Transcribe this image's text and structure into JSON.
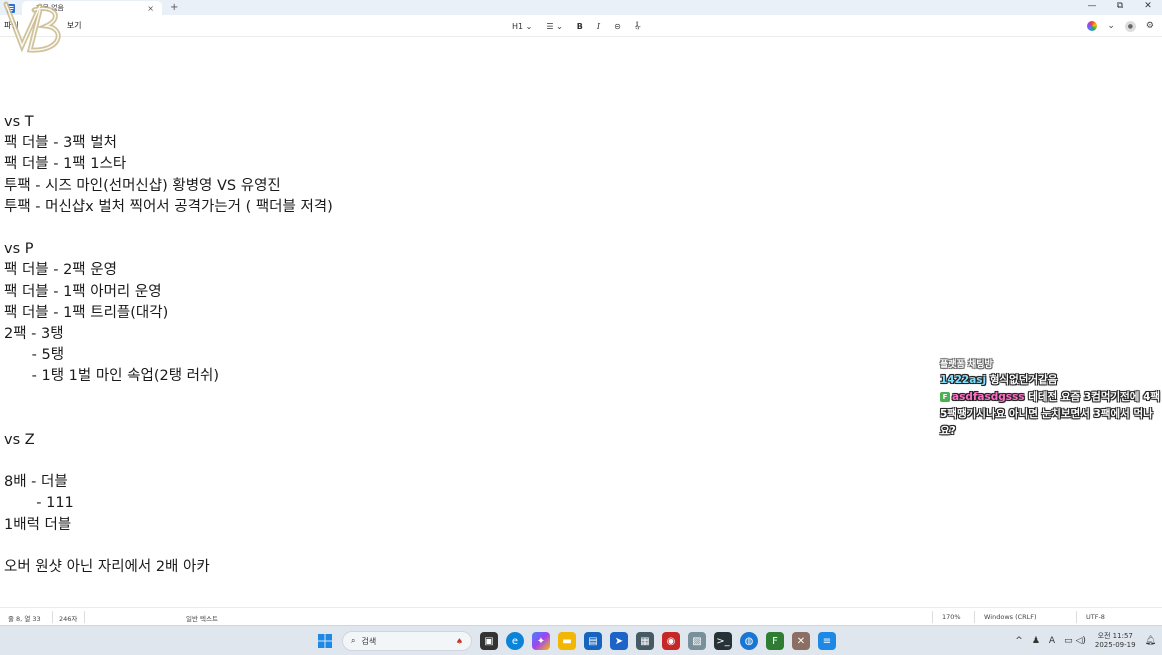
{
  "window": {
    "tab_title": "제목 없음",
    "tab_close": "×",
    "new_tab": "+",
    "minimize": "—",
    "maximize": "⧉",
    "close": "✕"
  },
  "menubar": {
    "file": "파일",
    "view": "보기"
  },
  "toolbar": {
    "heading": "H1 ⌄",
    "list": "☰ ⌄",
    "bold": "B",
    "italic": "I",
    "link": "⊝",
    "clear": "ᢤ",
    "copilot_chevron": "⌄",
    "settings": "⚙"
  },
  "document": {
    "lines": [
      "vs T",
      "팩 더블 - 3팩 벌처",
      "팩 더블 - 1팩 1스타",
      "투팩 - 시즈 마인(선머신샵) 황병영 VS 유영진",
      "투팩 - 머신샵x 벌처 찍어서 공격가는거 ( 팩더블 저격)",
      "",
      "vs P",
      "팩 더블 - 2팩 운영",
      "팩 더블 - 1팩 아머리 운영",
      "팩 더블 - 1팩 트리플(대각)",
      "2팩 - 3탱",
      "      - 5탱",
      "      - 1탱 1벌 마인 속업(2탱 러쉬)",
      "",
      "",
      "vs Z",
      "",
      "8배 - 더블",
      "       - 111",
      "1배럭 더블",
      "",
      "오버 원샷 아닌 자리에서 2배 아카"
    ]
  },
  "statusbar": {
    "position": "줄 8, 열 33",
    "char_count": "246자",
    "format": "일반 텍스트",
    "zoom": "170%",
    "line_ending": "Windows (CRLF)",
    "encoding": "UTF-8"
  },
  "chat_overlay": {
    "title": "플랫폼 채팅방",
    "messages": [
      {
        "user": "1422asj",
        "text": " 형식없던거같음"
      },
      {
        "badge": "F",
        "user": "asdfasdgsss",
        "text": " 테테전 요즘 3컴먹기전에 4팩5팩땡기시나요 아니면 눈치보면서 3팩에서 먹나요?"
      }
    ]
  },
  "taskbar": {
    "search_placeholder": "검색",
    "tray_chevron": "^",
    "tray_lang": "A",
    "time": "오전 11:57",
    "date": "2025-09-19"
  }
}
